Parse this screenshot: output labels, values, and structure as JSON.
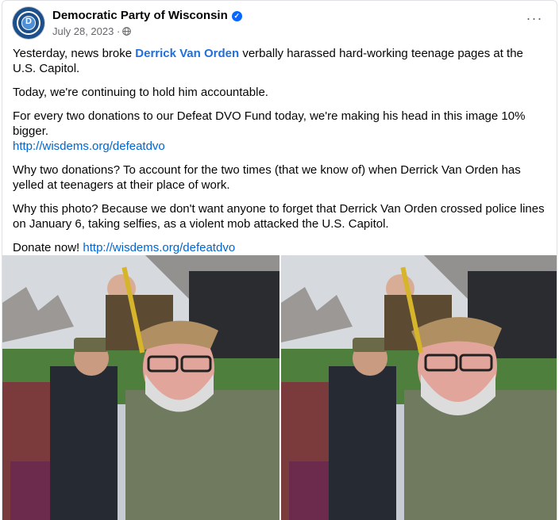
{
  "post": {
    "page_name": "Democratic Party of Wisconsin",
    "date": "July 28, 2023",
    "meta_separator": "·",
    "more_label": "···"
  },
  "body": {
    "p1_before": "Yesterday, news broke ",
    "p1_tag": "Derrick Van Orden",
    "p1_after": " verbally harassed hard-working teenage pages at the U.S. Capitol.",
    "p2": "Today, we're continuing to hold him accountable.",
    "p3_text": "For every two donations to our Defeat DVO Fund today, we're making his head in this image 10% bigger.",
    "p3_link": "http://wisdems.org/defeatdvo",
    "p4": "Why two donations? To account for the two times (that we know of) when Derrick Van Orden has yelled at teenagers at their place of work.",
    "p5": "Why this photo? Because we don't want anyone to forget that Derrick Van Orden crossed police lines  on January 6, taking selfies, as a violent mob attacked the U.S. Capitol.",
    "p6_text": "Donate now! ",
    "p6_link": "http://wisdems.org/defeatdvo"
  },
  "icons": {
    "avatar": "party-logo-icon",
    "verified": "verified-badge-icon",
    "audience": "globe-icon",
    "more": "more-options-icon"
  },
  "colors": {
    "link": "#0064d1",
    "verified": "#0866ff",
    "meta": "#65676b"
  }
}
